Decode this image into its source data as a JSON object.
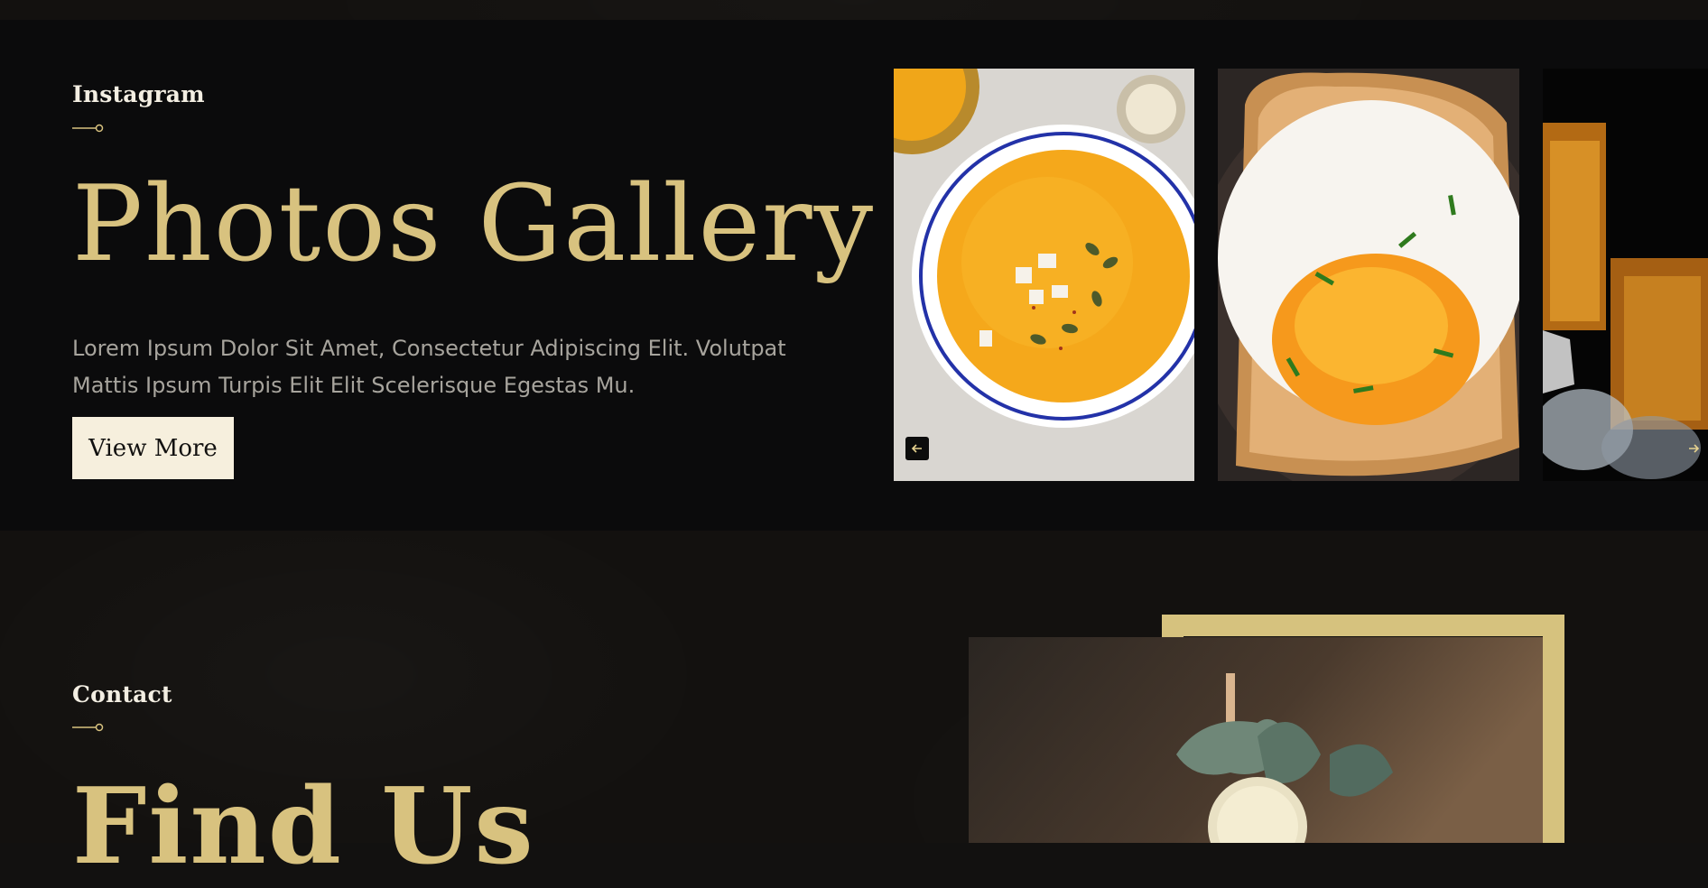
{
  "gallery": {
    "eyebrow": "Instagram",
    "title": "Photos Gallery",
    "description": "Lorem Ipsum Dolor Sit Amet, Consectetur Adipiscing Elit. Volutpat Mattis Ipsum Turpis Elit Elit Scelerisque Egestas Mu.",
    "button_label": "View More",
    "photos": [
      {
        "subject": "pumpkin-soup",
        "icon": "instagram-icon"
      },
      {
        "subject": "fried-egg-toast",
        "icon": "instagram-icon"
      },
      {
        "subject": "whiskey-glass",
        "icon": "instagram-icon"
      }
    ],
    "prev_icon": "arrow-left-icon",
    "next_icon": "arrow-right-icon"
  },
  "contact": {
    "eyebrow": "Contact",
    "title": "Find Us"
  },
  "colors": {
    "gold": "#d8c27f",
    "cream_button": "#f6efdd",
    "band_bg": "#0b0b0c",
    "page_bg": "#13110f"
  }
}
